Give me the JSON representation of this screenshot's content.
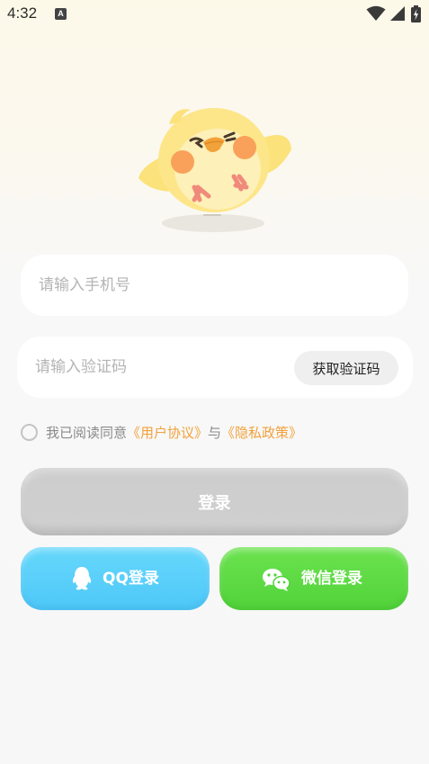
{
  "status_bar": {
    "time": "4:32",
    "app_icon_letter": "A"
  },
  "phone_field": {
    "placeholder": "请输入手机号",
    "value": ""
  },
  "code_field": {
    "placeholder": "请输入验证码",
    "value": "",
    "get_code_label": "获取验证码"
  },
  "agreement": {
    "prefix": "我已阅读同意",
    "user_agreement": "《用户协议》",
    "conjunction": "与",
    "privacy_policy": "《隐私政策》",
    "checked": false
  },
  "login_button": {
    "label": "登录"
  },
  "social": {
    "qq_label": "QQ登录",
    "wechat_label": "微信登录"
  },
  "colors": {
    "link": "#f2a13b",
    "qq": "#4ec8f8",
    "wechat": "#52d33a",
    "login_disabled": "#cccccc"
  }
}
